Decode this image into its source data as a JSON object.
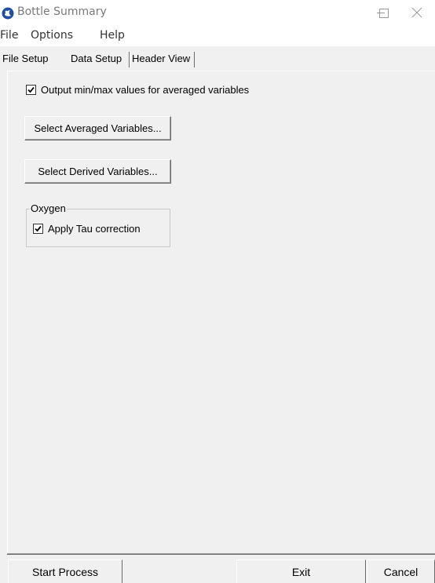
{
  "window": {
    "title": "Bottle Summary",
    "app_icon": "seabird-logo-icon",
    "controls": [
      "minimize-icon",
      "maximize-icon",
      "close-icon"
    ]
  },
  "menu": {
    "items": [
      {
        "label": "File"
      },
      {
        "label": "Options"
      },
      {
        "label": "Help"
      }
    ]
  },
  "tabs": [
    {
      "label": "File Setup",
      "selected": false
    },
    {
      "label": "Data Setup",
      "selected": true
    },
    {
      "label": "Header View",
      "selected": false
    }
  ],
  "data_setup": {
    "minmax_checkbox": {
      "label": "Output min/max values for averaged variables",
      "checked": true
    },
    "select_averaged_button": "Select Averaged Variables...",
    "select_derived_button": "Select Derived Variables...",
    "oxygen_group": {
      "title": "Oxygen",
      "tau_checkbox": {
        "label": "Apply Tau correction",
        "checked": true
      }
    }
  },
  "footer": {
    "start_process": "Start Process",
    "exit": "Exit",
    "cancel": "Cancel"
  },
  "colors": {
    "logo_blue": "#1e4fa0",
    "panel_bg": "#f0f0f0",
    "title_text": "#7a7a7a"
  }
}
